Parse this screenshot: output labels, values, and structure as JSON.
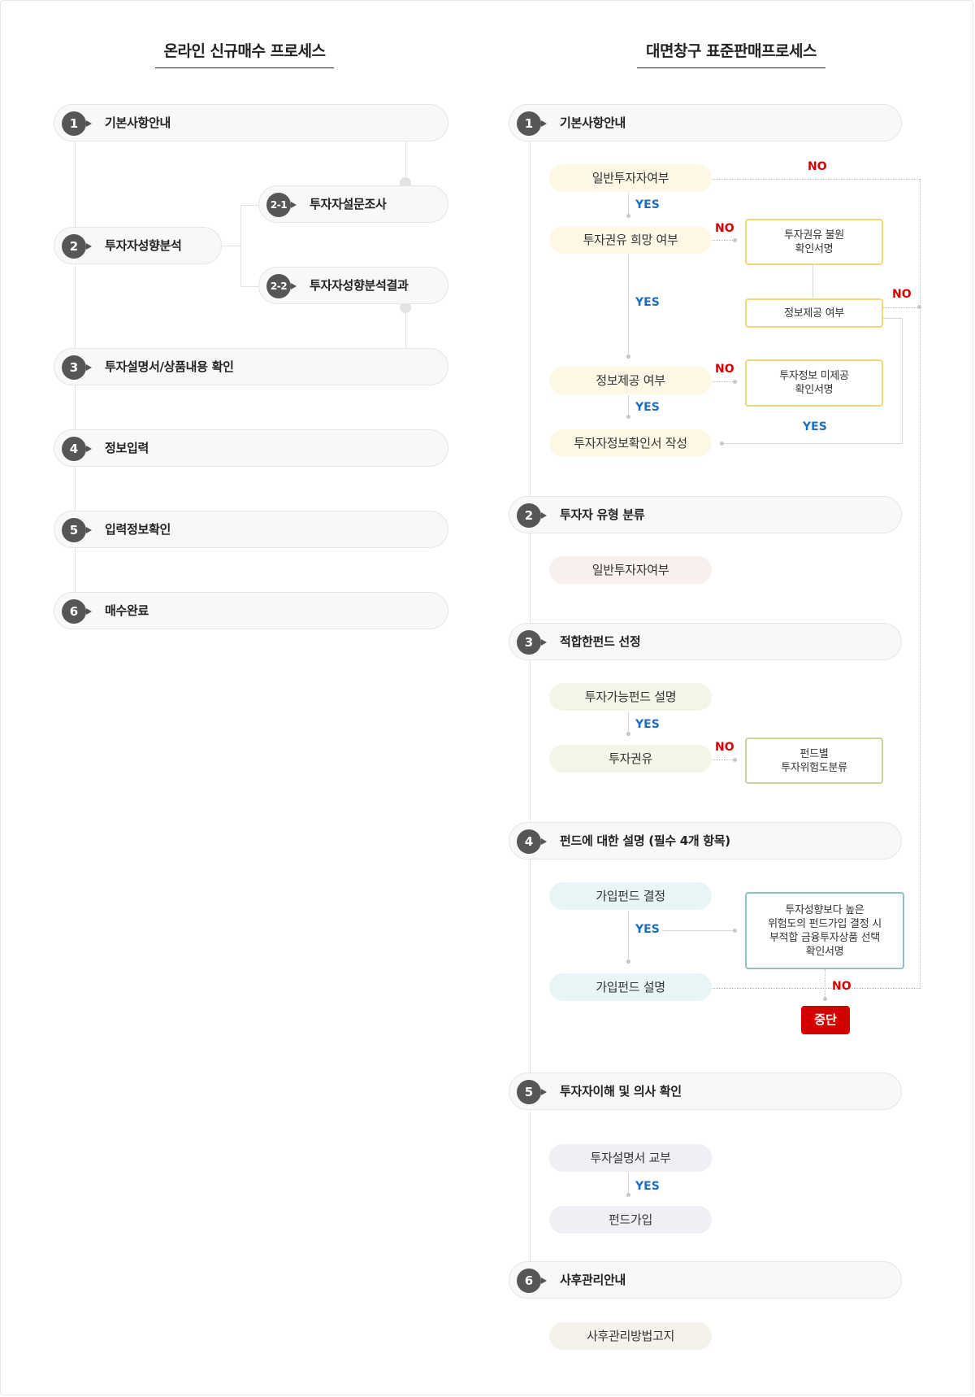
{
  "left": {
    "title": "온라인 신규매수 프로세스",
    "steps": [
      {
        "num": "1",
        "label": "기본사항안내"
      },
      {
        "num": "2",
        "label": "투자자성향분석"
      },
      {
        "num": "2-1",
        "label": "투자자설문조사"
      },
      {
        "num": "2-2",
        "label": "투자자성향분석결과"
      },
      {
        "num": "3",
        "label": "투자설명서/상품내용 확인"
      },
      {
        "num": "4",
        "label": "정보입력"
      },
      {
        "num": "5",
        "label": "입력정보확인"
      },
      {
        "num": "6",
        "label": "매수완료"
      }
    ]
  },
  "right": {
    "title": "대면창구 표준판매프로세스",
    "stages": [
      {
        "num": "1",
        "label": "기본사항안내"
      },
      {
        "num": "2",
        "label": "투자자 유형 분류"
      },
      {
        "num": "3",
        "label": "적합한펀드 선정"
      },
      {
        "num": "4",
        "label": "펀드에 대한 설명 (필수 4개 항목)"
      },
      {
        "num": "5",
        "label": "투자자이해 및 의사 확인"
      },
      {
        "num": "6",
        "label": "사후관리안내"
      }
    ],
    "s1": {
      "general": "일반투자자여부",
      "want": "투자권유 희망 여부",
      "info": "정보제공 여부",
      "write": "투자자정보확인서 작성",
      "box_unwanted": [
        "투자권유 불원",
        "확인서명"
      ],
      "box_info": "정보제공 여부",
      "box_noinfo": [
        "투자정보 미제공",
        "확인서명"
      ]
    },
    "s2": {
      "general": "일반투자자여부"
    },
    "s3": {
      "explain": "투자가능펀드 설명",
      "recommend": "투자권유",
      "box": [
        "펀드별",
        "투자위험도분류"
      ]
    },
    "s4": {
      "decide": "가입펀드 결정",
      "explain": "가입펀드 설명",
      "box": [
        "투자성향보다 높은",
        "위험도의 펀드가입 결정 시",
        "부적합 금융투자상품 선택",
        "확인서명"
      ],
      "stop": "중단"
    },
    "s5": {
      "deliver": "투자설명서 교부",
      "join": "펀드가입"
    },
    "s6": {
      "notice": "사후관리방법고지"
    },
    "yes": "YES",
    "no": "NO"
  },
  "colors": {
    "yes": "#1a6fc4",
    "no": "#d40000",
    "box_yellow": "#f2d67a",
    "box_green": "#c6d49e",
    "box_teal": "#8ec1c4",
    "stop": "#d40000"
  }
}
